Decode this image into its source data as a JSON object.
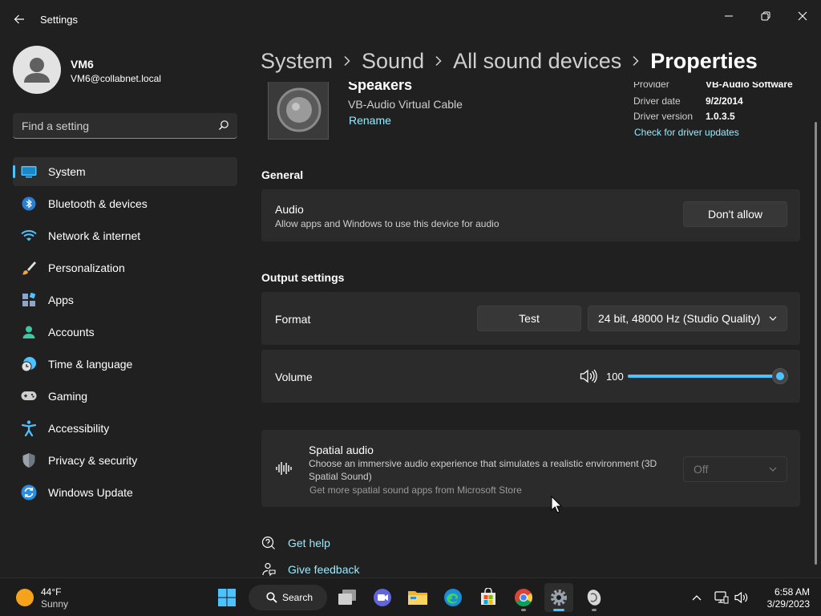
{
  "window": {
    "title": "Settings",
    "controls": [
      "minimize",
      "maximize",
      "close"
    ]
  },
  "user": {
    "name": "VM6",
    "email": "VM6@collabnet.local"
  },
  "search": {
    "placeholder": "Find a setting"
  },
  "sidebar": {
    "items": [
      {
        "label": "System",
        "icon": "monitor-icon",
        "active": true
      },
      {
        "label": "Bluetooth & devices",
        "icon": "bluetooth-icon"
      },
      {
        "label": "Network & internet",
        "icon": "wifi-icon"
      },
      {
        "label": "Personalization",
        "icon": "brush-icon"
      },
      {
        "label": "Apps",
        "icon": "apps-icon"
      },
      {
        "label": "Accounts",
        "icon": "person-icon"
      },
      {
        "label": "Time & language",
        "icon": "clock-globe-icon"
      },
      {
        "label": "Gaming",
        "icon": "gamepad-icon"
      },
      {
        "label": "Accessibility",
        "icon": "accessibility-icon"
      },
      {
        "label": "Privacy & security",
        "icon": "shield-icon"
      },
      {
        "label": "Windows Update",
        "icon": "update-icon"
      }
    ]
  },
  "breadcrumb": {
    "items": [
      "System",
      "Sound",
      "All sound devices"
    ],
    "current": "Properties"
  },
  "device": {
    "name": "Speakers",
    "subtitle": "VB-Audio Virtual Cable",
    "rename_label": "Rename",
    "driver": {
      "provider_label": "Provider",
      "provider_value": "VB-Audio Software",
      "date_label": "Driver date",
      "date_value": "9/2/2014",
      "version_label": "Driver version",
      "version_value": "1.0.3.5",
      "update_link": "Check for driver updates"
    }
  },
  "general": {
    "heading": "General",
    "audio": {
      "title": "Audio",
      "description": "Allow apps and Windows to use this device for audio",
      "button": "Don't allow"
    }
  },
  "output": {
    "heading": "Output settings",
    "format": {
      "title": "Format",
      "test_button": "Test",
      "selected": "24 bit, 48000 Hz (Studio Quality)"
    },
    "volume": {
      "title": "Volume",
      "value": "100",
      "fraction": 1.0
    }
  },
  "spatial": {
    "title": "Spatial audio",
    "description_line1": "Choose an immersive audio experience that simulates a realistic environment (3D",
    "description_line2": "Spatial Sound)",
    "store_link": "Get more spatial sound apps from Microsoft Store",
    "selected": "Off"
  },
  "help": {
    "get_help": "Get help",
    "give_feedback": "Give feedback"
  },
  "taskbar": {
    "weather_temp": "44°F",
    "weather_condition": "Sunny",
    "search_label": "Search",
    "apps": [
      "start-icon",
      "search-icon",
      "task-view-icon",
      "teams-chat-icon",
      "file-explorer-icon",
      "edge-icon",
      "store-icon",
      "chrome-icon",
      "settings-icon",
      "app-icon"
    ],
    "time": "6:58 AM",
    "date": "3/29/2023"
  },
  "colors": {
    "background": "#202020",
    "card": "#2b2b2b",
    "accent": "#4cc2ff",
    "link": "#99ebff"
  }
}
